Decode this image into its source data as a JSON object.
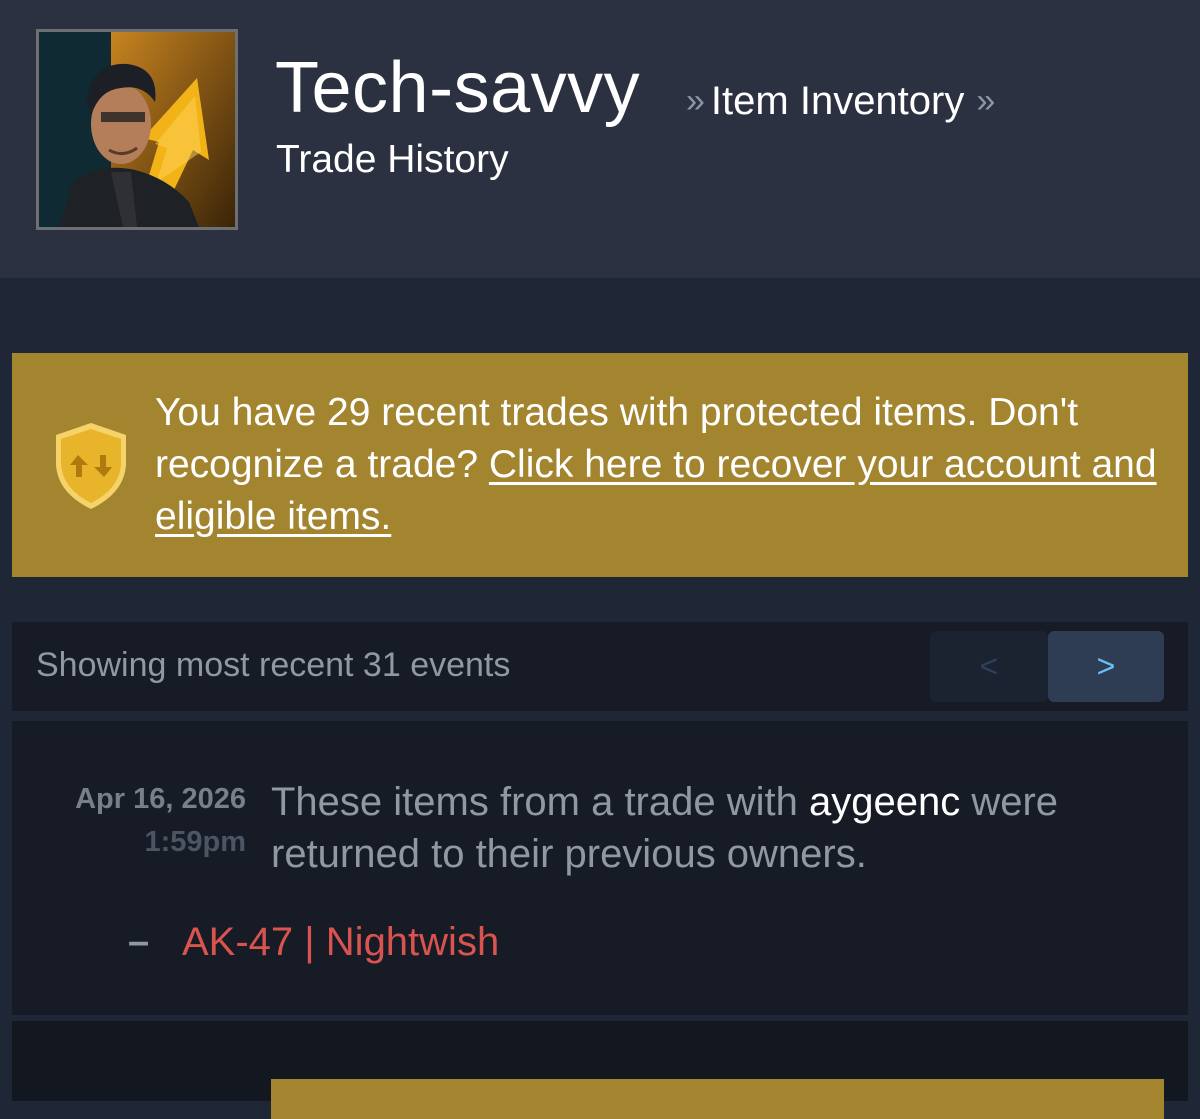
{
  "header": {
    "persona_name": "Tech-savvy",
    "separator": "»",
    "inventory_link": "Item Inventory",
    "page_title": "Trade History"
  },
  "notice": {
    "text_before": "You have 29 recent trades with protected items. Don't recognize a trade? ",
    "link_text": "Click here to recover your account and eligible items.",
    "icon": "shield-trade-icon",
    "color": "#a3842f"
  },
  "paging": {
    "label": "Showing most recent 31 events",
    "prev_label": "<",
    "next_label": ">"
  },
  "events": [
    {
      "date": "Apr 16, 2026",
      "time": "1:59pm",
      "desc_before": "These items from a trade with ",
      "partner": "aygeenc",
      "desc_after": " were returned to their previous owners.",
      "item_prefix": "–",
      "item_name": "AK-47 | Nightwish",
      "item_color": "#d9534f"
    }
  ],
  "colors": {
    "background": "#1f2636",
    "header": "#2b3140",
    "panel": "#161b25",
    "accent_link": "#66c0f4"
  }
}
